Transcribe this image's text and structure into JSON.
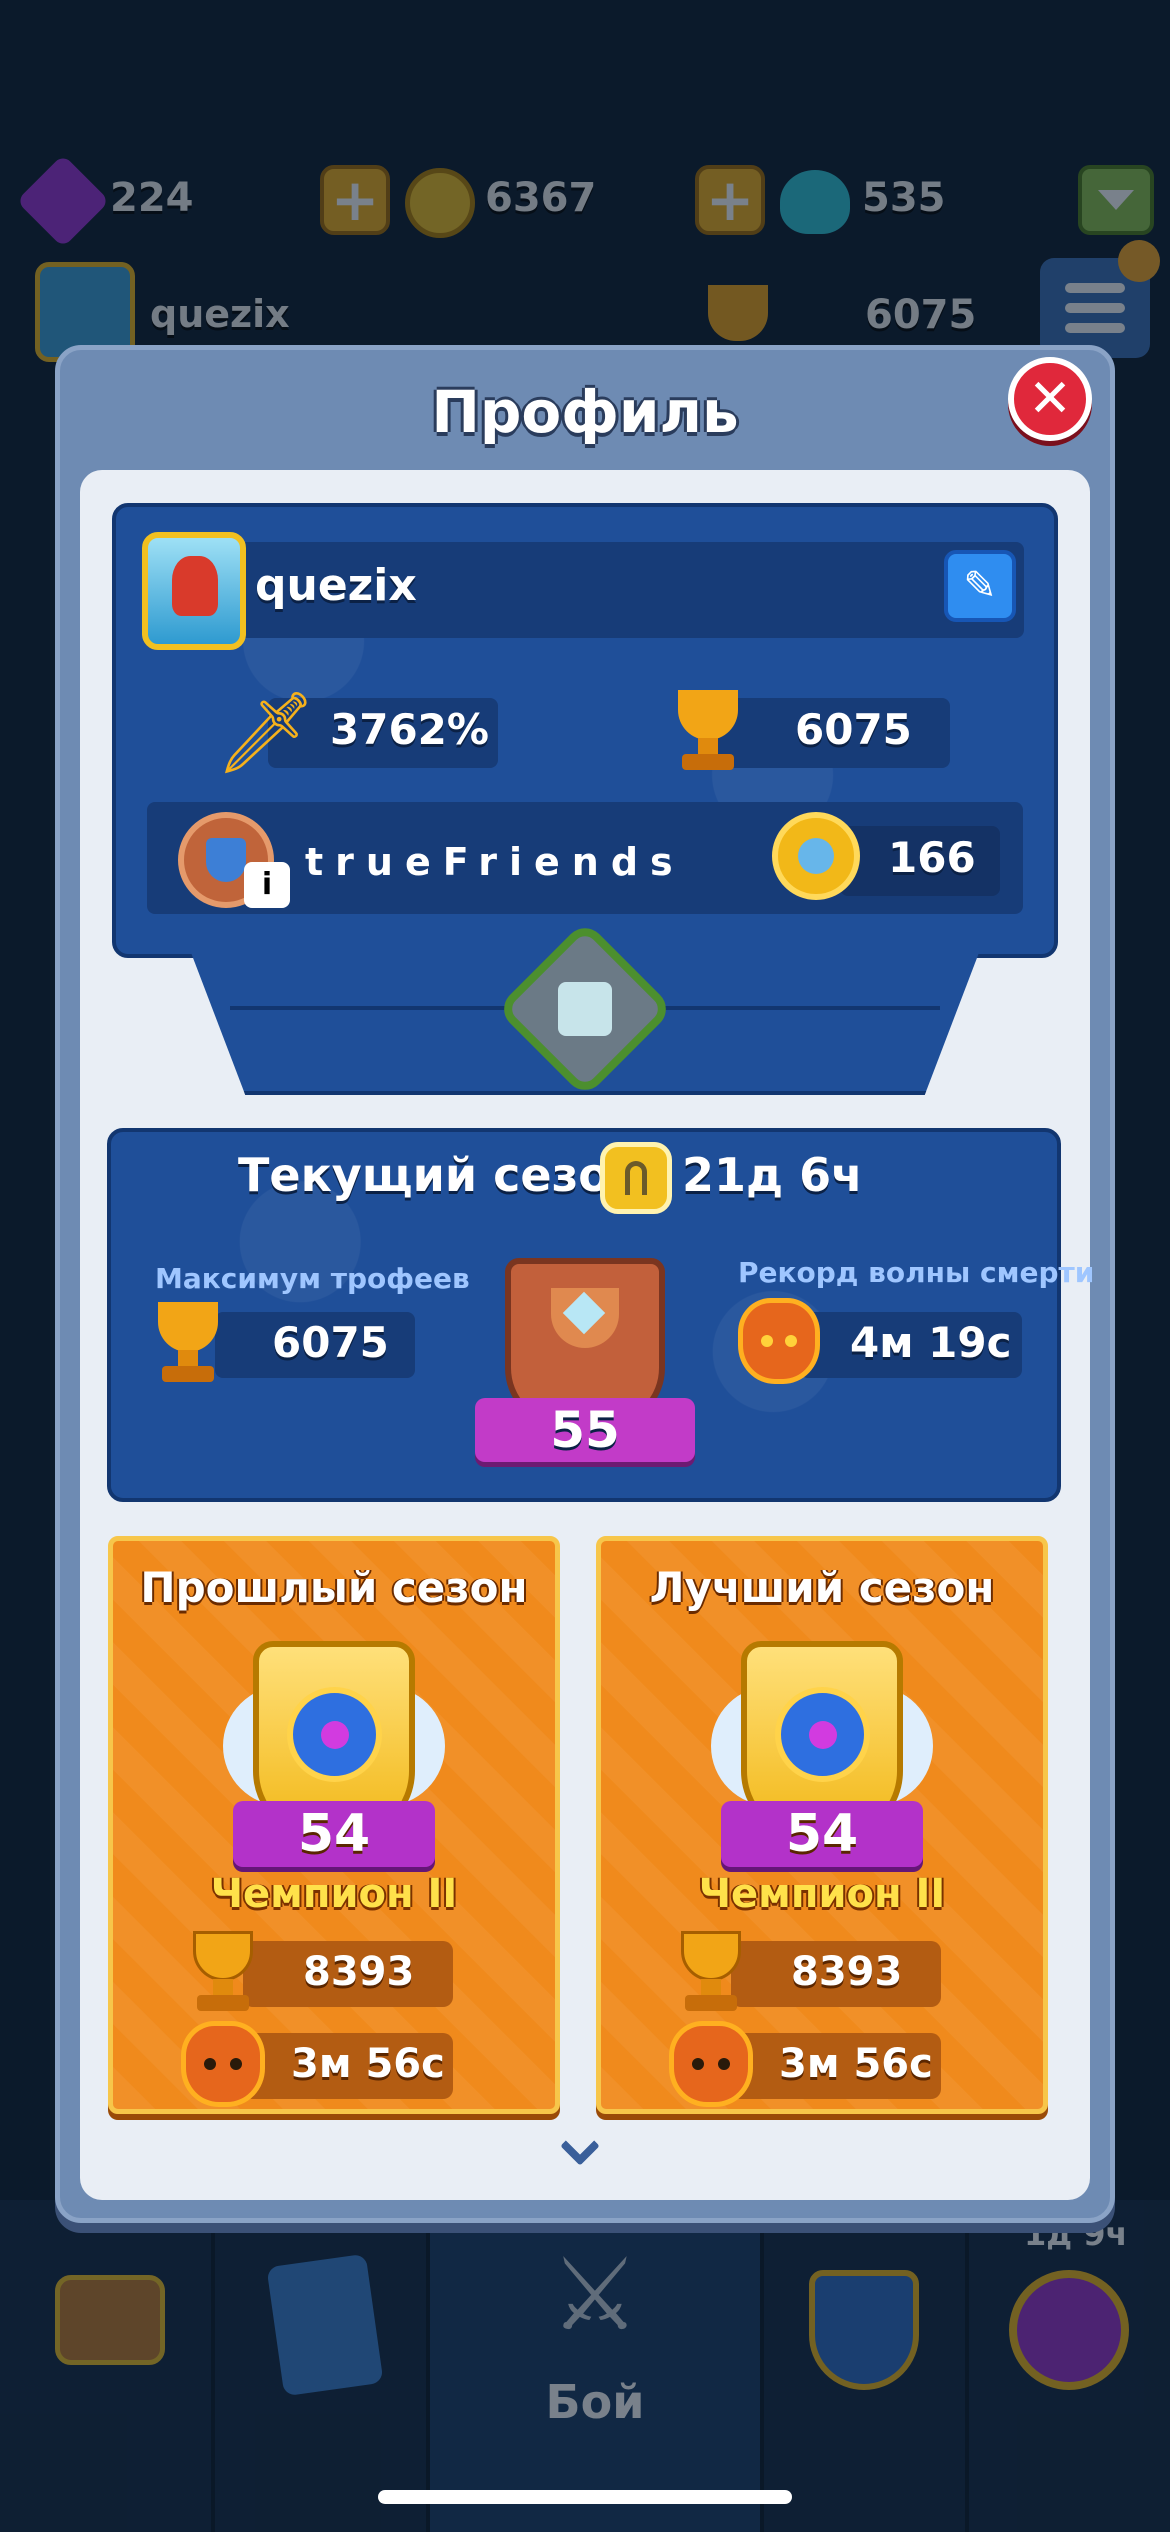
{
  "hud": {
    "gems": "224",
    "coins": "6367",
    "elixir": "535",
    "player_name": "quezix",
    "trophies": "6075"
  },
  "modal": {
    "title": "Профиль"
  },
  "profile": {
    "name": "quezix",
    "crit_percent": "3762%",
    "trophies": "6075",
    "clan_name": "trueFriends",
    "medals": "166"
  },
  "season": {
    "label": "Текущий сезон:",
    "time_left": "21д 6ч",
    "max_trophies_label": "Максимум трофеев",
    "max_trophies": "6075",
    "death_wave_label": "Рекорд волны смерти",
    "death_wave": "4м 19с",
    "league_level": "55"
  },
  "past_season": {
    "title": "Прошлый сезон",
    "level": "54",
    "rank": "Чемпион II",
    "trophies": "8393",
    "death_wave": "3м 56с"
  },
  "best_season": {
    "title": "Лучший сезон",
    "level": "54",
    "rank": "Чемпион II",
    "trophies": "8393",
    "death_wave": "3м 56с"
  },
  "bottom_nav": {
    "battle_label": "Бой",
    "badge": "1д 9ч"
  },
  "colors": {
    "modal_frame": "#6e8bb3",
    "panel_blue": "#1f4f99",
    "card_orange": "#f08a1c",
    "close_red": "#e0283b",
    "rank_yellow": "#ffe14a"
  }
}
